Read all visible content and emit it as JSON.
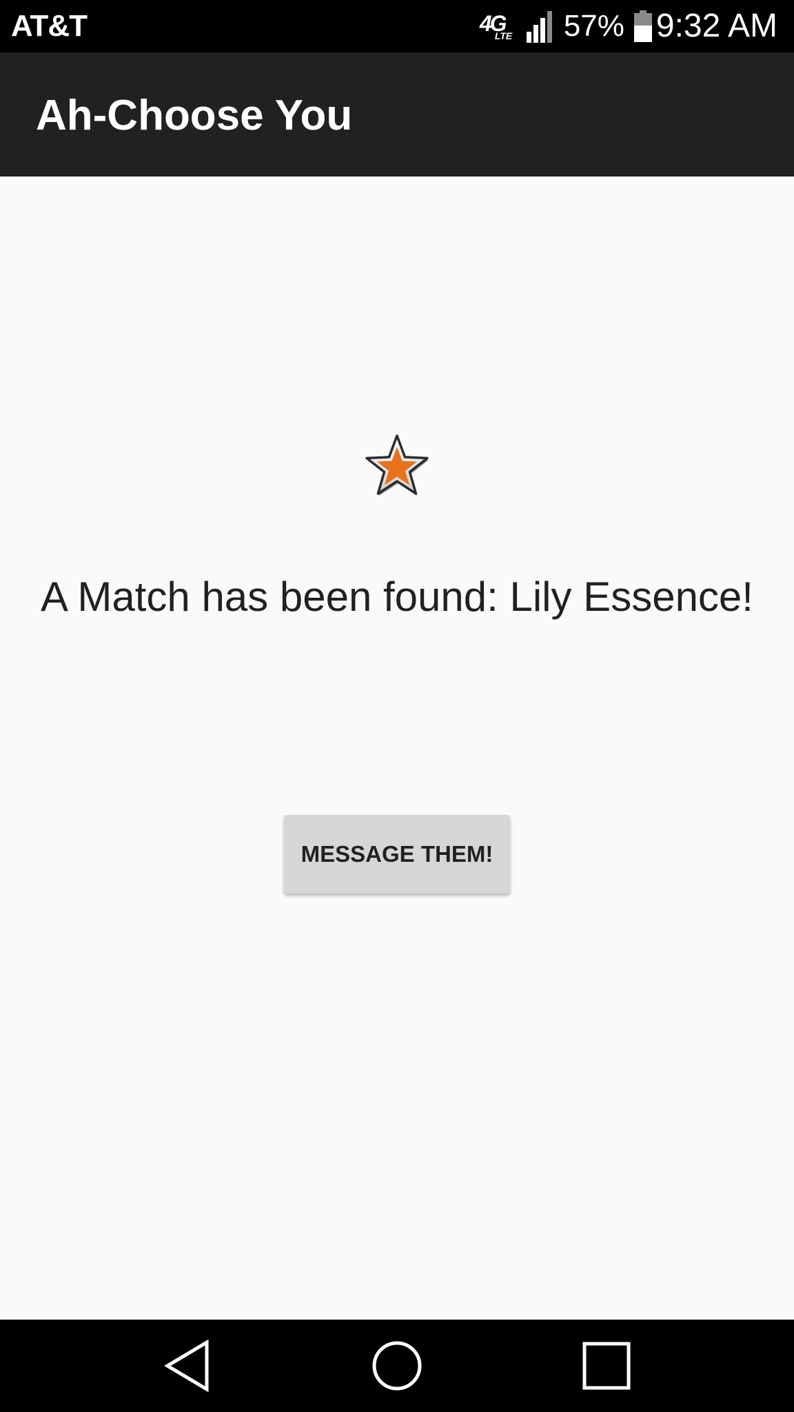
{
  "status_bar": {
    "carrier": "AT&T",
    "network_main": "4G",
    "network_sub": "LTE",
    "battery_percent": "57%",
    "battery_level": 0.57,
    "signal_bars_filled": 3,
    "signal_bars_total": 4,
    "time": "9:32 AM"
  },
  "app_bar": {
    "title": "Ah-Choose You"
  },
  "main": {
    "star_icon": "star-icon",
    "star_color": "#e8731c",
    "match_message": "A Match has been found: Lily Essence!",
    "message_button_label": "MESSAGE THEM!"
  },
  "nav_bar": {
    "back_icon": "back-triangle-icon",
    "home_icon": "home-circle-icon",
    "recents_icon": "recents-square-icon"
  },
  "colors": {
    "app_bar_bg": "#212121",
    "content_bg": "#fafafa",
    "button_bg": "#d6d6d6",
    "system_bars_bg": "#000000"
  }
}
